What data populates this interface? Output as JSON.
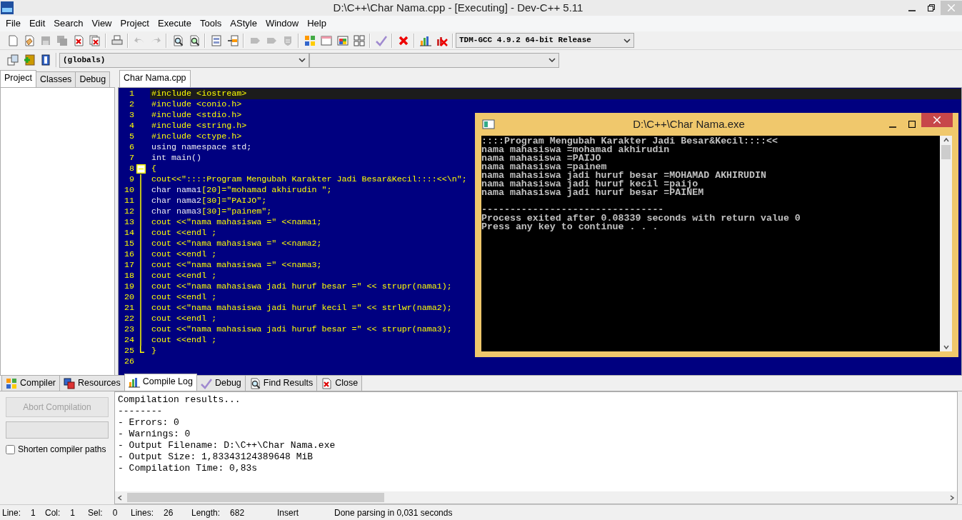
{
  "window": {
    "title": "D:\\C++\\Char Nama.cpp - [Executing] - Dev-C++ 5.11"
  },
  "menu": [
    "File",
    "Edit",
    "Search",
    "View",
    "Project",
    "Execute",
    "Tools",
    "AStyle",
    "Window",
    "Help"
  ],
  "main_toolbar": [
    {
      "kind": "new",
      "disabled": false
    },
    {
      "kind": "open",
      "disabled": false
    },
    {
      "kind": "save",
      "disabled": true
    },
    {
      "kind": "save_all",
      "disabled": true
    },
    {
      "kind": "close",
      "disabled": false
    },
    {
      "kind": "close_all",
      "disabled": false
    },
    {
      "kind": "separator"
    },
    {
      "kind": "print",
      "disabled": false
    },
    {
      "kind": "separator"
    },
    {
      "kind": "undo",
      "disabled": true
    },
    {
      "kind": "redo",
      "disabled": true
    },
    {
      "kind": "separator"
    },
    {
      "kind": "find",
      "disabled": false
    },
    {
      "kind": "replace",
      "disabled": false
    },
    {
      "kind": "separator"
    },
    {
      "kind": "list",
      "disabled": false
    },
    {
      "kind": "goto",
      "disabled": false
    },
    {
      "kind": "separator"
    },
    {
      "kind": "bookmark",
      "disabled": true
    },
    {
      "kind": "bookmark",
      "disabled": true
    },
    {
      "kind": "shield",
      "disabled": true
    },
    {
      "kind": "separator"
    },
    {
      "kind": "compile",
      "disabled": false
    },
    {
      "kind": "run",
      "disabled": false
    },
    {
      "kind": "compile_run",
      "disabled": false
    },
    {
      "kind": "rebuild",
      "disabled": false
    },
    {
      "kind": "separator"
    },
    {
      "kind": "check",
      "disabled": false
    },
    {
      "kind": "separator"
    },
    {
      "kind": "stop",
      "disabled": false
    },
    {
      "kind": "separator"
    },
    {
      "kind": "chart",
      "disabled": false
    },
    {
      "kind": "delete_chart",
      "disabled": false
    },
    {
      "kind": "separator"
    }
  ],
  "compiler_select": {
    "value": "TDM-GCC 4.9.2 64-bit Release"
  },
  "second_toolbar": [
    {
      "kind": "insert",
      "disabled": false
    },
    {
      "kind": "add",
      "disabled": false
    },
    {
      "kind": "book",
      "disabled": false
    }
  ],
  "scope_select": {
    "value": "(globals)"
  },
  "left_tabs": [
    {
      "label": "Project",
      "selected": true
    },
    {
      "label": "Classes",
      "selected": false
    },
    {
      "label": "Debug",
      "selected": false
    }
  ],
  "editor_tabs": [
    {
      "label": "Char Nama.cpp",
      "selected": true
    }
  ],
  "code_lines": [
    {
      "num": "1",
      "selected": true,
      "kind": "plain",
      "segments": [
        {
          "kind": "text",
          "text": "#include <iostream>"
        }
      ]
    },
    {
      "num": "2",
      "selected": false,
      "kind": "plain",
      "segments": [
        {
          "kind": "text",
          "text": "#include <conio.h>"
        }
      ]
    },
    {
      "num": "3",
      "selected": false,
      "kind": "plain",
      "segments": [
        {
          "kind": "text",
          "text": "#include <stdio.h>"
        }
      ]
    },
    {
      "num": "4",
      "selected": false,
      "kind": "plain",
      "segments": [
        {
          "kind": "text",
          "text": "#include <string.h>"
        }
      ]
    },
    {
      "num": "5",
      "selected": false,
      "kind": "plain",
      "segments": [
        {
          "kind": "text",
          "text": "#include <ctype.h>"
        }
      ]
    },
    {
      "num": "6",
      "selected": false,
      "kind": "plain",
      "segments": [
        {
          "kind": "keyword",
          "text": "using namespace std;"
        }
      ]
    },
    {
      "num": "7",
      "selected": false,
      "kind": "plain",
      "segments": [
        {
          "kind": "keyword",
          "text": "int main()"
        }
      ]
    },
    {
      "num": "8",
      "selected": false,
      "kind": "fold_start",
      "segments": [
        {
          "kind": "text",
          "text": "{"
        }
      ]
    },
    {
      "num": "9",
      "selected": false,
      "kind": "fold_inside",
      "segments": [
        {
          "kind": "text",
          "text": "cout<<\"::::Program Mengubah Karakter Jadi Besar&Kecil::::<<\\n\";"
        }
      ]
    },
    {
      "num": "10",
      "selected": false,
      "kind": "fold_inside",
      "segments": [
        {
          "kind": "keyword",
          "text": "char nama1"
        },
        {
          "kind": "text",
          "text": "[20]=\"mohamad akhirudin \";"
        }
      ]
    },
    {
      "num": "11",
      "selected": false,
      "kind": "fold_inside",
      "segments": [
        {
          "kind": "keyword",
          "text": "char nama2"
        },
        {
          "kind": "text",
          "text": "[30]=\"PAIJO\";"
        }
      ]
    },
    {
      "num": "12",
      "selected": false,
      "kind": "fold_inside",
      "segments": [
        {
          "kind": "keyword",
          "text": "char nama3"
        },
        {
          "kind": "text",
          "text": "[30]=\"painem\";"
        }
      ]
    },
    {
      "num": "13",
      "selected": false,
      "kind": "fold_inside",
      "segments": [
        {
          "kind": "text",
          "text": "cout <<\"nama mahasiswa =\" <<nama1;"
        }
      ]
    },
    {
      "num": "14",
      "selected": false,
      "kind": "fold_inside",
      "segments": [
        {
          "kind": "text",
          "text": "cout <<endl ;"
        }
      ]
    },
    {
      "num": "15",
      "selected": false,
      "kind": "fold_inside",
      "segments": [
        {
          "kind": "text",
          "text": "cout <<\"nama mahasiswa =\" <<nama2;"
        }
      ]
    },
    {
      "num": "16",
      "selected": false,
      "kind": "fold_inside",
      "segments": [
        {
          "kind": "text",
          "text": "cout <<endl ;"
        }
      ]
    },
    {
      "num": "17",
      "selected": false,
      "kind": "fold_inside",
      "segments": [
        {
          "kind": "text",
          "text": "cout <<\"nama mahasiswa =\" <<nama3;"
        }
      ]
    },
    {
      "num": "18",
      "selected": false,
      "kind": "fold_inside",
      "segments": [
        {
          "kind": "text",
          "text": "cout <<endl ;"
        }
      ]
    },
    {
      "num": "19",
      "selected": false,
      "kind": "fold_inside",
      "segments": [
        {
          "kind": "text",
          "text": "cout <<\"nama mahasiswa jadi huruf besar =\" << strupr(nama1);"
        }
      ]
    },
    {
      "num": "20",
      "selected": false,
      "kind": "fold_inside",
      "segments": [
        {
          "kind": "text",
          "text": "cout <<endl ;"
        }
      ]
    },
    {
      "num": "21",
      "selected": false,
      "kind": "fold_inside",
      "segments": [
        {
          "kind": "text",
          "text": "cout <<\"nama mahasiswa jadi huruf kecil =\" << strlwr(nama2);"
        }
      ]
    },
    {
      "num": "22",
      "selected": false,
      "kind": "fold_inside",
      "segments": [
        {
          "kind": "text",
          "text": "cout <<endl ;"
        }
      ]
    },
    {
      "num": "23",
      "selected": false,
      "kind": "fold_inside",
      "segments": [
        {
          "kind": "text",
          "text": "cout <<\"nama mahasiswa jadi huruf besar =\" << strupr(nama3);"
        }
      ]
    },
    {
      "num": "24",
      "selected": false,
      "kind": "fold_inside",
      "segments": [
        {
          "kind": "text",
          "text": "cout <<endl ;"
        }
      ]
    },
    {
      "num": "25",
      "selected": false,
      "kind": "fold_end",
      "segments": [
        {
          "kind": "text",
          "text": "}"
        }
      ]
    },
    {
      "num": "26",
      "selected": false,
      "kind": "plain"
    }
  ],
  "console": {
    "title": "D:\\C++\\Char Nama.exe",
    "output": [
      "::::Program Mengubah Karakter Jadi Besar&Kecil::::<<",
      "nama mahasiswa =mohamad akhirudin",
      "nama mahasiswa =PAIJO",
      "nama mahasiswa =painem",
      "nama mahasiswa jadi huruf besar =MOHAMAD AKHIRUDIN",
      "nama mahasiswa jadi huruf kecil =paijo",
      "nama mahasiswa jadi huruf besar =PAINEM"
    ],
    "footer": [
      "--------------------------------",
      "Process exited after 0.08339 seconds with return value 0",
      "Press any key to continue . . ."
    ]
  },
  "bottom_tabs": [
    {
      "label": "Compiler",
      "kind": "compiler",
      "selected": false
    },
    {
      "label": "Resources",
      "kind": "resources",
      "selected": false
    },
    {
      "label": "Compile Log",
      "kind": "log",
      "selected": true
    },
    {
      "label": "Debug",
      "kind": "debug",
      "selected": false
    },
    {
      "label": "Find Results",
      "kind": "find",
      "selected": false
    },
    {
      "label": "Close",
      "kind": "close",
      "selected": false
    }
  ],
  "abort_button": {
    "label": "Abort Compilation",
    "disabled": true
  },
  "progress": {
    "level": 0
  },
  "shorten_paths": {
    "label": "Shorten compiler paths",
    "checked": false
  },
  "compile_log": [
    "Compilation results...",
    "--------",
    "- Errors: 0",
    "- Warnings: 0",
    "- Output Filename: D:\\C++\\Char Nama.exe",
    "- Output Size: 1,83343124389648 MiB",
    "- Compilation Time: 0,83s"
  ],
  "status_bar": [
    {
      "label": "Line:",
      "value": "1"
    },
    {
      "label": "Col:",
      "value": "1"
    },
    {
      "label": "Sel:",
      "value": "0"
    },
    {
      "label": "Lines:",
      "value": "26"
    },
    {
      "label": "Length:",
      "value": "682"
    },
    {
      "value": "Insert"
    },
    {
      "value": "Done parsing in 0,031 seconds"
    }
  ]
}
